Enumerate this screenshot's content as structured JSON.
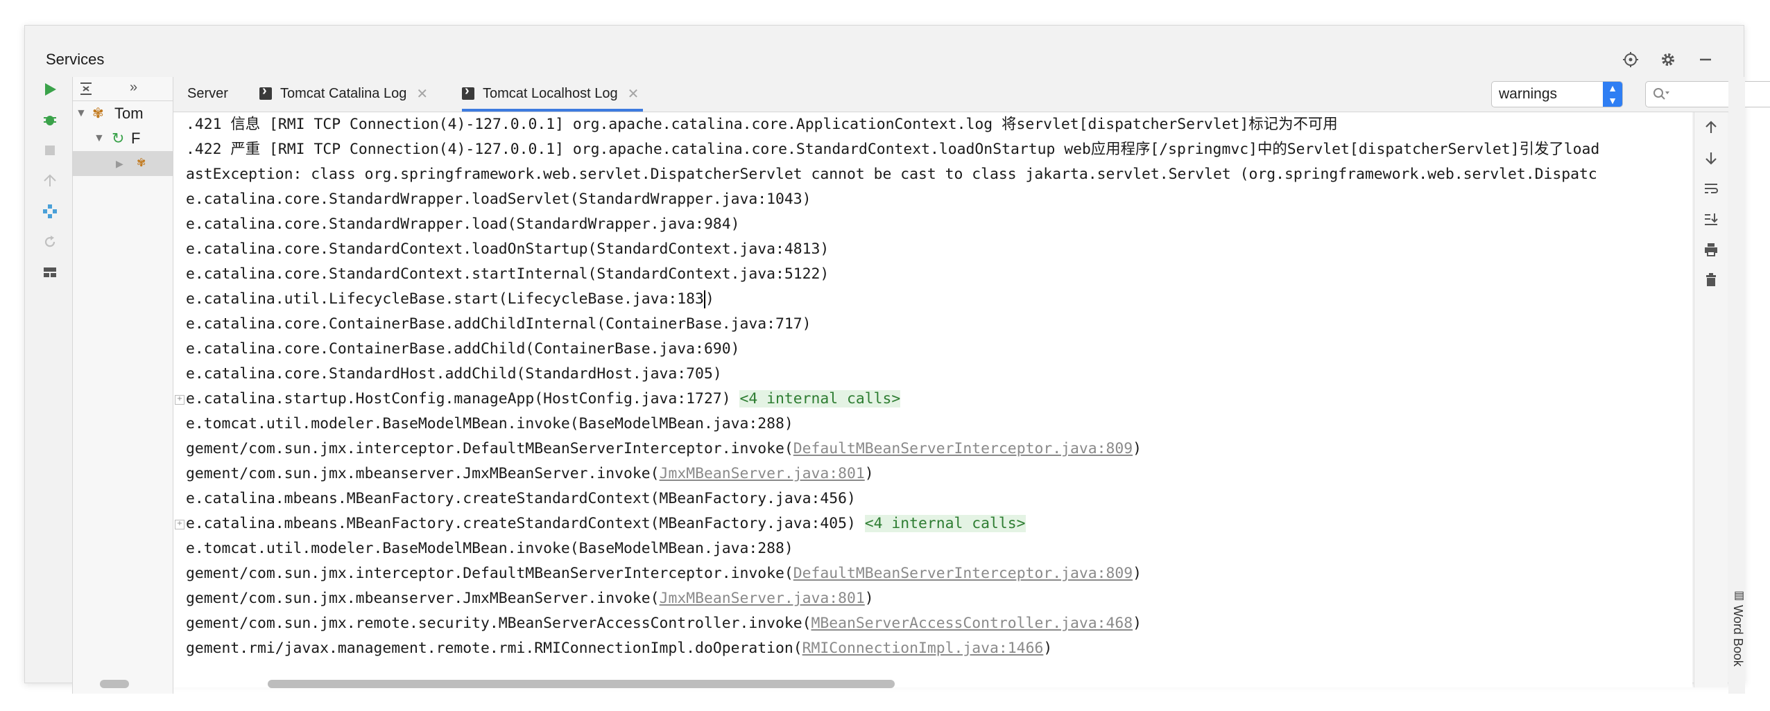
{
  "window": {
    "title": "Services"
  },
  "tree": {
    "items": [
      {
        "label": "Tom"
      },
      {
        "label": "F"
      },
      {
        "label": ""
      }
    ]
  },
  "tabs": [
    {
      "label": "Server"
    },
    {
      "label": "Tomcat Catalina Log"
    },
    {
      "label": "Tomcat Localhost Log"
    }
  ],
  "filter": {
    "selected": "warnings"
  },
  "search": {
    "placeholder": ""
  },
  "log_lines": [
    {
      "text": ".421 信息 [RMI TCP Connection(4)-127.0.0.1] org.apache.catalina.core.ApplicationContext.log 将servlet[dispatcherServlet]标记为不可用"
    },
    {
      "text": ".422 严重 [RMI TCP Connection(4)-127.0.0.1] org.apache.catalina.core.StandardContext.loadOnStartup web应用程序[/springmvc]中的Servlet[dispatcherServlet]引发了load"
    },
    {
      "text": "astException: class org.springframework.web.servlet.DispatcherServlet cannot be cast to class jakarta.servlet.Servlet (org.springframework.web.servlet.Dispatc"
    },
    {
      "text": "e.catalina.core.StandardWrapper.loadServlet(StandardWrapper.java:1043)"
    },
    {
      "text": "e.catalina.core.StandardWrapper.load(StandardWrapper.java:984)"
    },
    {
      "text": "e.catalina.core.StandardContext.loadOnStartup(StandardContext.java:4813)"
    },
    {
      "text": "e.catalina.core.StandardContext.startInternal(StandardContext.java:5122)"
    },
    {
      "text": "e.catalina.util.LifecycleBase.start(LifecycleBase.java:183",
      "after": ")"
    },
    {
      "text": "e.catalina.core.ContainerBase.addChildInternal(ContainerBase.java:717)"
    },
    {
      "text": "e.catalina.core.ContainerBase.addChild(ContainerBase.java:690)"
    },
    {
      "text": "e.catalina.core.StandardHost.addChild(StandardHost.java:705)"
    },
    {
      "text": "e.catalina.startup.HostConfig.manageApp(HostConfig.java:1727) ",
      "internal": "<4 internal calls>"
    },
    {
      "text": "e.tomcat.util.modeler.BaseModelMBean.invoke(BaseModelMBean.java:288)"
    },
    {
      "text": "gement/com.sun.jmx.interceptor.DefaultMBeanServerInterceptor.invoke(",
      "link": "DefaultMBeanServerInterceptor.java:809",
      "after": ")"
    },
    {
      "text": "gement/com.sun.jmx.mbeanserver.JmxMBeanServer.invoke(",
      "link": "JmxMBeanServer.java:801",
      "after": ")"
    },
    {
      "text": "e.catalina.mbeans.MBeanFactory.createStandardContext(MBeanFactory.java:456)"
    },
    {
      "text": "e.catalina.mbeans.MBeanFactory.createStandardContext(MBeanFactory.java:405) ",
      "internal": "<4 internal calls>"
    },
    {
      "text": "e.tomcat.util.modeler.BaseModelMBean.invoke(BaseModelMBean.java:288)"
    },
    {
      "text": "gement/com.sun.jmx.interceptor.DefaultMBeanServerInterceptor.invoke(",
      "link": "DefaultMBeanServerInterceptor.java:809",
      "after": ")"
    },
    {
      "text": "gement/com.sun.jmx.mbeanserver.JmxMBeanServer.invoke(",
      "link": "JmxMBeanServer.java:801",
      "after": ")"
    },
    {
      "text": "gement/com.sun.jmx.remote.security.MBeanServerAccessController.invoke(",
      "link": "MBeanServerAccessController.java:468",
      "after": ")"
    },
    {
      "text": "gement.rmi/javax.management.remote.rmi.RMIConnectionImpl.doOperation(",
      "link": "RMIConnectionImpl.java:1466",
      "after": ")"
    }
  ],
  "side_label": "Word Book",
  "colors": {
    "accent": "#3d7be0",
    "link": "#8a8a8a",
    "internal_bg": "#e4f3e4",
    "internal_fg": "#2e7d32"
  },
  "icons": {
    "window": [
      "crosshair-icon",
      "gear-icon",
      "minimize-icon"
    ],
    "left_toolbar": [
      "run-icon",
      "debug-icon",
      "stop-icon",
      "deploy-icon",
      "services-icon",
      "refresh-icon",
      "layout-icon"
    ],
    "right_toolbar": [
      "arrow-up-icon",
      "arrow-down-icon",
      "soft-wrap-icon",
      "scroll-to-end-icon",
      "print-icon",
      "trash-icon"
    ]
  }
}
